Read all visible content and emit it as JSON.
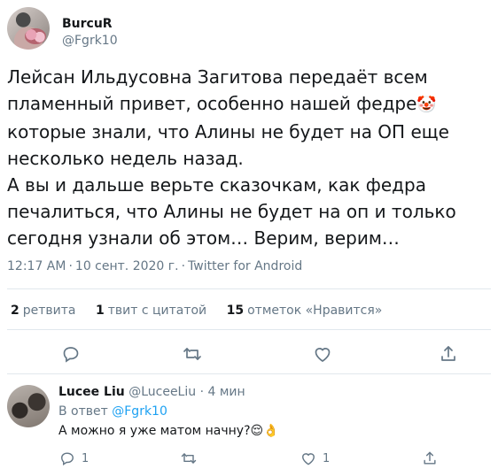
{
  "tweet": {
    "author_name": "BurcuR",
    "author_handle": "@Fgrk10",
    "text": "Лейсан Ильдусовна Загитова передаёт всем\nпламенный привет, особенно нашей федре",
    "clown_emoji": "🤡",
    "text2": "\nкоторые знали, что Алины не будет на ОП еще\nнесколько недель назад.\nА вы и дальше верьте сказочкам, как федра\nпечалиться, что Алины не будет на оп и только\nсегодня узнали об этом… Верим, верим…",
    "time": "12:17 AM",
    "date": "10 сент. 2020 г.",
    "source": "Twitter for Android"
  },
  "stats": {
    "retweets_count": "2",
    "retweets_label": "ретвита",
    "quotes_count": "1",
    "quotes_label": "твит с цитатой",
    "likes_count": "15",
    "likes_label": "отметок «Нравится»"
  },
  "reply": {
    "name": "Lucee Liu",
    "handle": "@LuceeLiu",
    "dot": "·",
    "time": "4 мин",
    "to_prefix": "В ответ",
    "to_handle": "@Fgrk10",
    "text": "А можно я уже матом начну?😌👌",
    "reply_count": "1",
    "like_count": "1"
  },
  "colors": {
    "accent": "#1da1f2",
    "muted": "#657786",
    "border": "#e1e8ed"
  },
  "icons": [
    "reply-icon",
    "retweet-icon",
    "like-icon",
    "share-icon"
  ]
}
